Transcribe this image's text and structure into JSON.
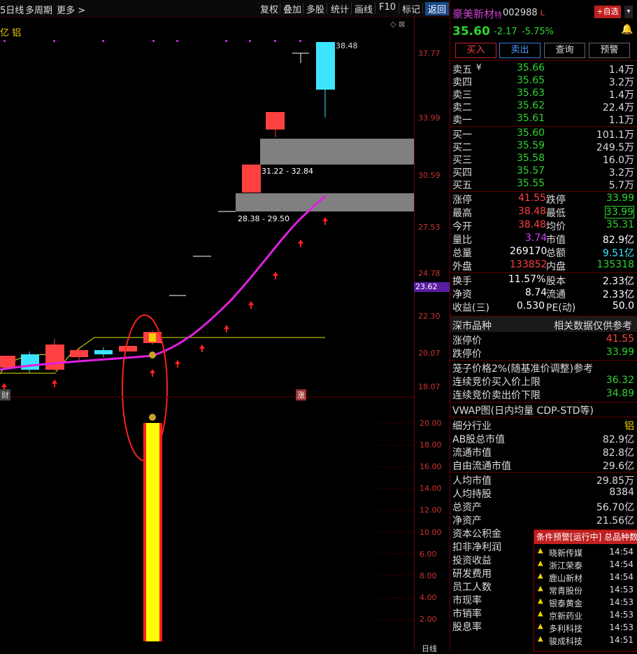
{
  "toolbar": {
    "period": "5日线",
    "multi_period": "多周期",
    "more": "更多 >",
    "buttons": [
      "复权",
      "叠加",
      "多股",
      "统计",
      "画线",
      "F10",
      "标记",
      "返回"
    ]
  },
  "chart": {
    "legend_left": "亿 铝",
    "price_axis": [
      "37.77",
      "33.99",
      "30.59",
      "27.53",
      "24.78",
      "22.30",
      "20.07",
      "18.07"
    ],
    "current_price_tag": "23.62",
    "high_label": "38.48",
    "zone_upper_label": "31.22 - 32.84",
    "zone_lower_label": "28.38 - 29.50",
    "bottom_tag_left": "财",
    "bottom_tag_mid": "涨",
    "volume_axis": [
      "20.00",
      "18.00",
      "16.00",
      "14.00",
      "12.00",
      "10.00",
      "8.00",
      "6.00",
      "4.00",
      "2.00"
    ],
    "bottom_right_label": "日线",
    "colors": {
      "up": "#ff4444",
      "down": "#3ce4ff",
      "ma": "#e020e0",
      "zone": "#808080",
      "volume_bar": "#ffff00",
      "circle": "#ff2020"
    }
  },
  "quote": {
    "name": "豪美新材",
    "name_suffix": "特",
    "code": "002988",
    "code_suffix": "L",
    "add_button": "+自选",
    "price": "35.60",
    "change": "-2.17",
    "change_pct": "-5.75%",
    "actions": [
      "买入",
      "卖出",
      "查询",
      "预警"
    ],
    "asks": [
      {
        "label": "卖五",
        "mark": "¥",
        "price": "35.66",
        "vol": "1.4万"
      },
      {
        "label": "卖四",
        "mark": "",
        "price": "35.65",
        "vol": "3.2万"
      },
      {
        "label": "卖三",
        "mark": "",
        "price": "35.63",
        "vol": "1.4万"
      },
      {
        "label": "卖二",
        "mark": "",
        "price": "35.62",
        "vol": "22.4万"
      },
      {
        "label": "卖一",
        "mark": "",
        "price": "35.61",
        "vol": "1.1万"
      }
    ],
    "bids": [
      {
        "label": "买一",
        "price": "35.60",
        "vol": "101.1万"
      },
      {
        "label": "买二",
        "price": "35.59",
        "vol": "249.5万"
      },
      {
        "label": "买三",
        "price": "35.58",
        "vol": "16.0万"
      },
      {
        "label": "买四",
        "price": "35.57",
        "vol": "3.2万"
      },
      {
        "label": "买五",
        "price": "35.55",
        "vol": "5.7万"
      }
    ],
    "stats": [
      {
        "l1": "涨停",
        "v1": "41.55",
        "c1": "red",
        "l2": "跌停",
        "v2": "33.99",
        "c2": "green"
      },
      {
        "l1": "最高",
        "v1": "38.48",
        "c1": "red",
        "l2": "最低",
        "v2": "33.99",
        "c2": "green"
      },
      {
        "l1": "今开",
        "v1": "38.48",
        "c1": "red",
        "l2": "均价",
        "v2": "35.31",
        "c2": "green"
      },
      {
        "l1": "量比",
        "v1": "3.74",
        "c1": "purple",
        "l2": "市值",
        "v2": "82.9亿",
        "c2": "white"
      },
      {
        "l1": "总量",
        "v1": "269170",
        "c1": "white",
        "l2": "总额",
        "v2": "9.51亿",
        "c2": "cyan"
      },
      {
        "l1": "外盘",
        "v1": "133852",
        "c1": "red",
        "l2": "内盘",
        "v2": "135318",
        "c2": "green"
      }
    ],
    "stats2": [
      {
        "l1": "换手",
        "v1": "11.57%",
        "l2": "股本",
        "v2": "2.33亿"
      },
      {
        "l1": "净资",
        "v1": "8.74",
        "l2": "流通",
        "v2": "2.33亿"
      },
      {
        "l1": "收益(三)",
        "v1": "0.530",
        "l2": "PE(动)",
        "v2": "50.0"
      }
    ],
    "section_market": "深市品种",
    "section_market_right": "相关数据仅供参考",
    "limit_up_label": "涨停价",
    "limit_up": "41.55",
    "limit_down_label": "跌停价",
    "limit_down": "33.99",
    "cage_title": "笼子价格2%(随基准价调整)参考",
    "cage_buy_label": "连续竞价买入价上限",
    "cage_buy": "36.32",
    "cage_sell_label": "连续竞价卖出价下限",
    "cage_sell": "34.89",
    "vwap_title": "VWAP图(日内均量 CDP-STD等)",
    "fundamentals": [
      {
        "l": "细分行业",
        "v": "铝",
        "c": "yellow"
      },
      {
        "l": "AB股总市值",
        "v": "82.9亿",
        "c": "white"
      },
      {
        "l": "流通市值",
        "v": "82.8亿",
        "c": "white"
      },
      {
        "l": "自由流通市值",
        "v": "29.6亿",
        "c": "white"
      }
    ],
    "fundamentals2": [
      {
        "l": "人均市值",
        "v": "29.85万"
      },
      {
        "l": "人均持股",
        "v": "8384"
      },
      {
        "l": "总资产",
        "v": "56.70亿"
      },
      {
        "l": "净资产",
        "v": "21.56亿"
      },
      {
        "l": "资本公积金",
        "v": ""
      },
      {
        "l": "扣非净利润",
        "v": ""
      },
      {
        "l": "投资收益",
        "v": ""
      },
      {
        "l": "研发费用",
        "v": ""
      },
      {
        "l": "员工人数",
        "v": ""
      },
      {
        "l": "市现率",
        "v": ""
      },
      {
        "l": "市销率",
        "v": ""
      },
      {
        "l": "股息率",
        "v": ""
      }
    ]
  },
  "alert": {
    "title": "条件预警[运行中] 总品种数",
    "rows": [
      {
        "name": "晓新传媒",
        "time": "14:54"
      },
      {
        "name": "浙江荣泰",
        "time": "14:54"
      },
      {
        "name": "鹿山新材",
        "time": "14:54"
      },
      {
        "name": "常青股份",
        "time": "14:53"
      },
      {
        "name": "银泰黄金",
        "time": "14:53"
      },
      {
        "name": "京新药业",
        "time": "14:53"
      },
      {
        "name": "多利科技",
        "time": "14:53"
      },
      {
        "name": "骏成科技",
        "time": "14:51"
      }
    ]
  }
}
